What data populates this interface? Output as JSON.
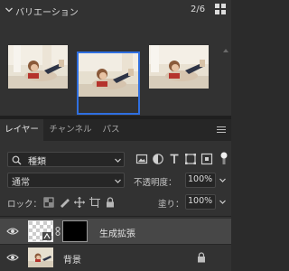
{
  "variations_panel": {
    "title": "バリエーション",
    "counter": "2/6",
    "thumbnails": [
      {
        "name": "variation-1",
        "selected": false
      },
      {
        "name": "variation-2",
        "selected": true
      },
      {
        "name": "variation-3",
        "selected": false
      }
    ]
  },
  "tabs": [
    {
      "label": "レイヤー",
      "active": true
    },
    {
      "label": "チャンネル",
      "active": false
    },
    {
      "label": "パス",
      "active": false
    }
  ],
  "filter": {
    "kind_label": "種類"
  },
  "filter_icons": [
    "image-filter-icon",
    "adjustment-filter-icon",
    "type-filter-icon",
    "shape-filter-icon",
    "smart-object-filter-icon"
  ],
  "blend": {
    "mode_value": "通常",
    "opacity_label": "不透明度：",
    "opacity_value": "100%"
  },
  "lock": {
    "label": "ロック：",
    "fill_label": "塗り：",
    "fill_value": "100%"
  },
  "layers": [
    {
      "name": "生成拡張",
      "selected": true,
      "visible": true,
      "has_mask": true,
      "locked": false
    },
    {
      "name": "背景",
      "selected": false,
      "visible": true,
      "has_mask": false,
      "locked": true
    }
  ],
  "colors": {
    "panel_bg": "#323232",
    "selection_blue": "#2f6fe0",
    "selected_row": "#474747"
  }
}
